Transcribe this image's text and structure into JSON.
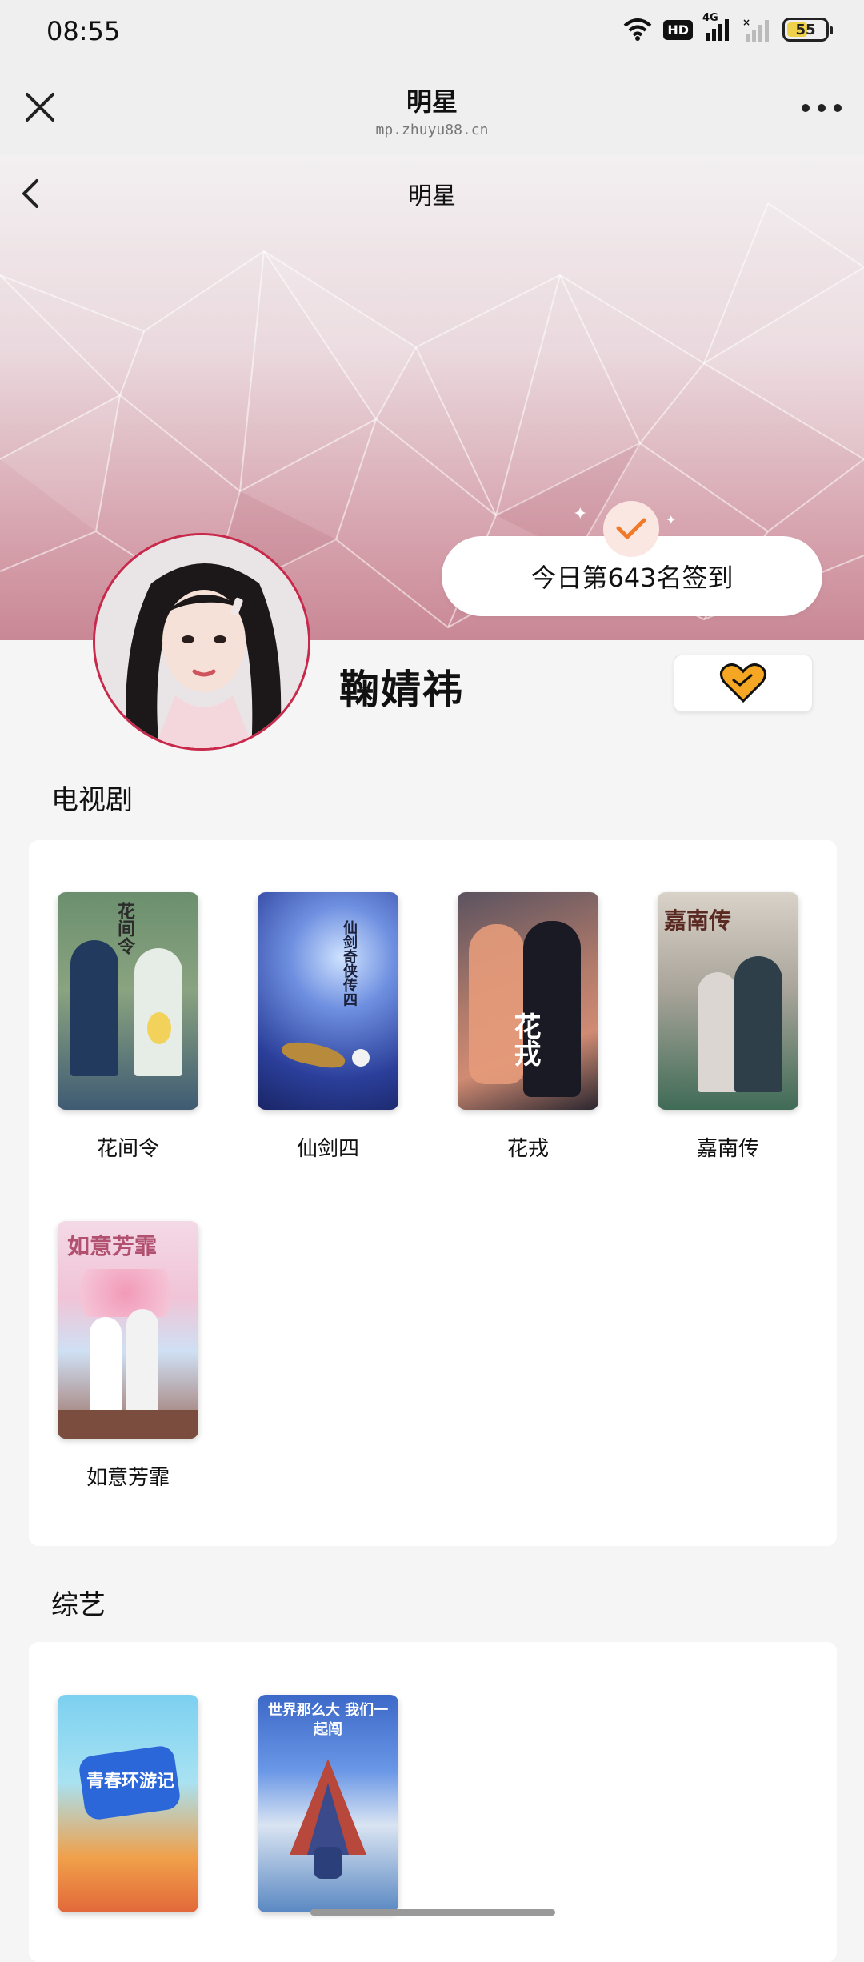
{
  "status_bar": {
    "time": "08:55",
    "network": "4G",
    "hd_label": "HD",
    "battery": "55",
    "battery_level": 0.55,
    "icons": [
      "wifi-icon",
      "hd-icon",
      "signal-4g-icon",
      "signal-no-sim-icon",
      "battery-icon"
    ]
  },
  "mini_program": {
    "title": "明星",
    "url": "mp.zhuyu88.cn",
    "close_icon": "close-icon",
    "more_icon": "more-icon"
  },
  "page": {
    "title": "明星",
    "back_icon": "chevron-left-icon"
  },
  "checkin": {
    "text": "今日第643名签到",
    "icon": "checkmark-icon"
  },
  "star": {
    "name": "鞠婧祎",
    "follow_icon": "heart-icon",
    "follow_color": "#f5a623"
  },
  "sections": {
    "tv": {
      "title": "电视剧",
      "items": [
        {
          "title": "花间令",
          "poster_text": "花间令"
        },
        {
          "title": "仙剑四",
          "poster_text": "仙剑奇侠传四"
        },
        {
          "title": "花戎",
          "poster_text": "花戎"
        },
        {
          "title": "嘉南传",
          "poster_text": "嘉南传"
        },
        {
          "title": "如意芳霏",
          "poster_text": "如意芳霏"
        }
      ]
    },
    "variety": {
      "title": "综艺",
      "items": [
        {
          "title": "青春环游记",
          "poster_text": "青春环游记"
        },
        {
          "title": "世界那么大我们一起闯",
          "poster_text": "世界那么大 我们一起闯"
        }
      ]
    }
  },
  "colors": {
    "accent": "#c8284a",
    "check": "#f07a2a",
    "banner": "#c98795"
  }
}
